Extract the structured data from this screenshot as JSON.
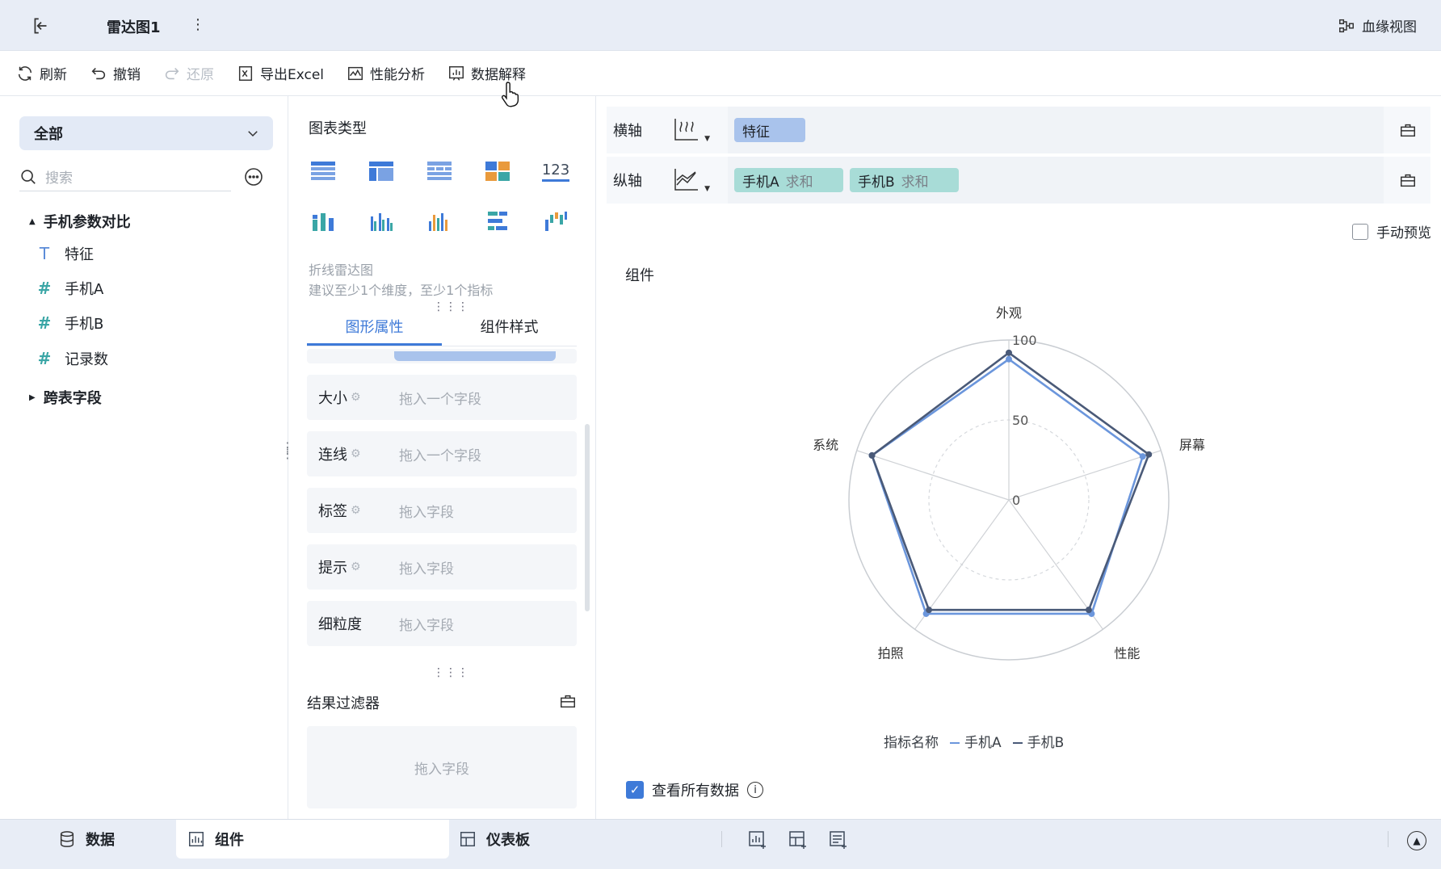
{
  "topbar": {
    "title": "雷达图1",
    "more": "⋮",
    "lineage_label": "血缘视图"
  },
  "toolbar": {
    "refresh": "刷新",
    "undo": "撤销",
    "redo": "还原",
    "export": "导出Excel",
    "perf": "性能分析",
    "explain": "数据解释"
  },
  "left": {
    "select_value": "全部",
    "search_placeholder": "搜索",
    "group": "手机参数对比",
    "fields": [
      {
        "icon": "T",
        "label": "特征"
      },
      {
        "icon": "#",
        "label": "手机A"
      },
      {
        "icon": "#",
        "label": "手机B"
      },
      {
        "icon": "#",
        "label": "记录数"
      }
    ],
    "cross_group": "跨表字段"
  },
  "middle": {
    "chart_type_title": "图表类型",
    "num_icon_label": "123",
    "chart_name": "折线雷达图",
    "chart_hint": "建议至少1个维度，至少1个指标",
    "tabs": [
      "图形属性",
      "组件样式"
    ],
    "props": [
      {
        "label": "大小",
        "placeholder": "拖入一个字段"
      },
      {
        "label": "连线",
        "placeholder": "拖入一个字段"
      },
      {
        "label": "标签",
        "placeholder": "拖入字段"
      },
      {
        "label": "提示",
        "placeholder": "拖入字段"
      },
      {
        "label": "细粒度",
        "placeholder": "拖入字段"
      }
    ],
    "filter_title": "结果过滤器",
    "filter_placeholder": "拖入字段"
  },
  "right": {
    "x_axis_label": "横轴",
    "x_pill": "特征",
    "y_axis_label": "纵轴",
    "y_pills": [
      {
        "name": "手机A",
        "agg": "求和"
      },
      {
        "name": "手机B",
        "agg": "求和"
      }
    ],
    "manual_preview": "手动预览",
    "component_title": "组件",
    "legend_title": "指标名称",
    "view_all": "查看所有数据",
    "info_glyph": "i"
  },
  "chart_data": {
    "type": "radar",
    "categories": [
      "外观",
      "屏幕",
      "性能",
      "拍照",
      "系统"
    ],
    "ticks": [
      "0",
      "50",
      "100"
    ],
    "rmax": 100,
    "series": [
      {
        "name": "手机A",
        "color": "#6b96dc",
        "values": [
          88,
          88,
          88,
          88,
          90
        ]
      },
      {
        "name": "手机B",
        "color": "#4a5a78",
        "values": [
          92,
          92,
          85,
          85,
          90
        ]
      }
    ]
  },
  "bottom": {
    "data_tab": "数据",
    "component_tab": "组件",
    "dashboard_tab": "仪表板"
  }
}
